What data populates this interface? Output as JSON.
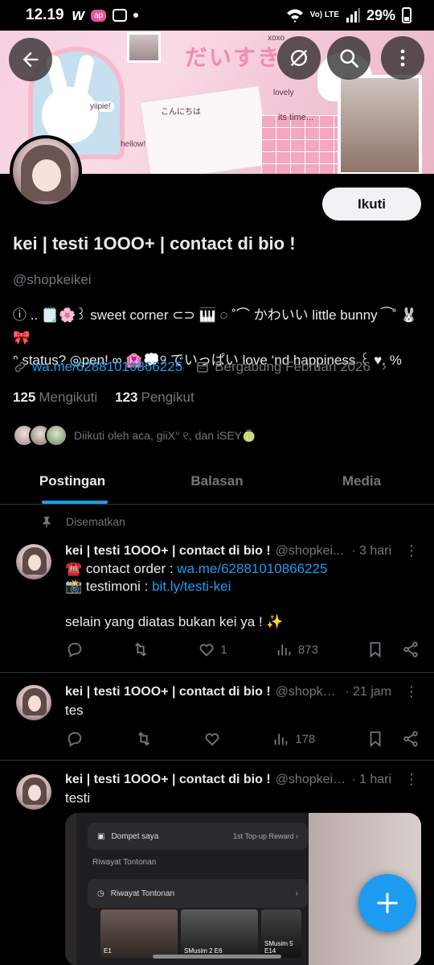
{
  "status_bar": {
    "time": "12.19",
    "w_badge": "w",
    "app_badge": "ap",
    "network": "Vo) LTE",
    "battery": "29%"
  },
  "banner": {
    "title": "だいすき",
    "texts": [
      "yiipie!",
      "its time...",
      "lovely",
      "hellow!",
      "xoxo",
      "こんにちは"
    ]
  },
  "profile": {
    "follow_label": "Ikuti",
    "name": "kei | testi 1OOO+ | contact di bio !",
    "handle": "@shopkeikei",
    "bio_line1": "ⓘ .. 🗒️🌸꒱ sweet corner ⊂⊃ 🎹 ◌ ˚⌒ かわいい little bunny ⁀˚ 🐰🎀",
    "bio_line2": "ᐢ status? ◎pen! ∞ 🏩💭୨ でいっぱい love ‘nd happiness ꒰ ♥︎. %",
    "link": "wa.me/62881010866225",
    "joined": "Bergabung Februari 2026",
    "following_count": "125",
    "following_label": "Mengikuti",
    "followers_count": "123",
    "followers_label": "Pengikut",
    "followed_by": "Diikuti oleh aca, giiX° ୧, dan iSEY🍈"
  },
  "tabs": [
    {
      "label": "Postingan"
    },
    {
      "label": "Balasan"
    },
    {
      "label": "Media"
    }
  ],
  "pinned_label": "Disematkan",
  "posts": [
    {
      "name": "kei | testi 1OOO+ | contact di bio !",
      "handle": "@shopkei...",
      "time": "· 3 hari",
      "line1_prefix": "☎️ contact order : ",
      "line1_link": "wa.me/62881010866225",
      "line2_prefix": "📸 testimoni : ",
      "line2_link": "bit.ly/testi-kei",
      "line3": "selain yang diatas bukan kei ya ! ✨",
      "likes": "1",
      "views": "873"
    },
    {
      "name": "kei | testi 1OOO+ | contact di bio !",
      "handle": "@shopkei...",
      "time": "· 21 jam",
      "text": "tes",
      "views": "178"
    },
    {
      "name": "kei | testi 1OOO+ | contact di bio !",
      "handle": "@shopkeikei",
      "time": "· 1 hari",
      "text": "testi"
    }
  ],
  "media_screenshot": {
    "wallet": "Dompet saya",
    "reward": "1st Top-up Reward",
    "history_header": "Riwayat Tontonan",
    "history_row": "Riwayat Tontonan",
    "thumb1": "E1",
    "thumb2": "SMusim 2 E6",
    "thumb3": "SMusim 5 E14"
  }
}
